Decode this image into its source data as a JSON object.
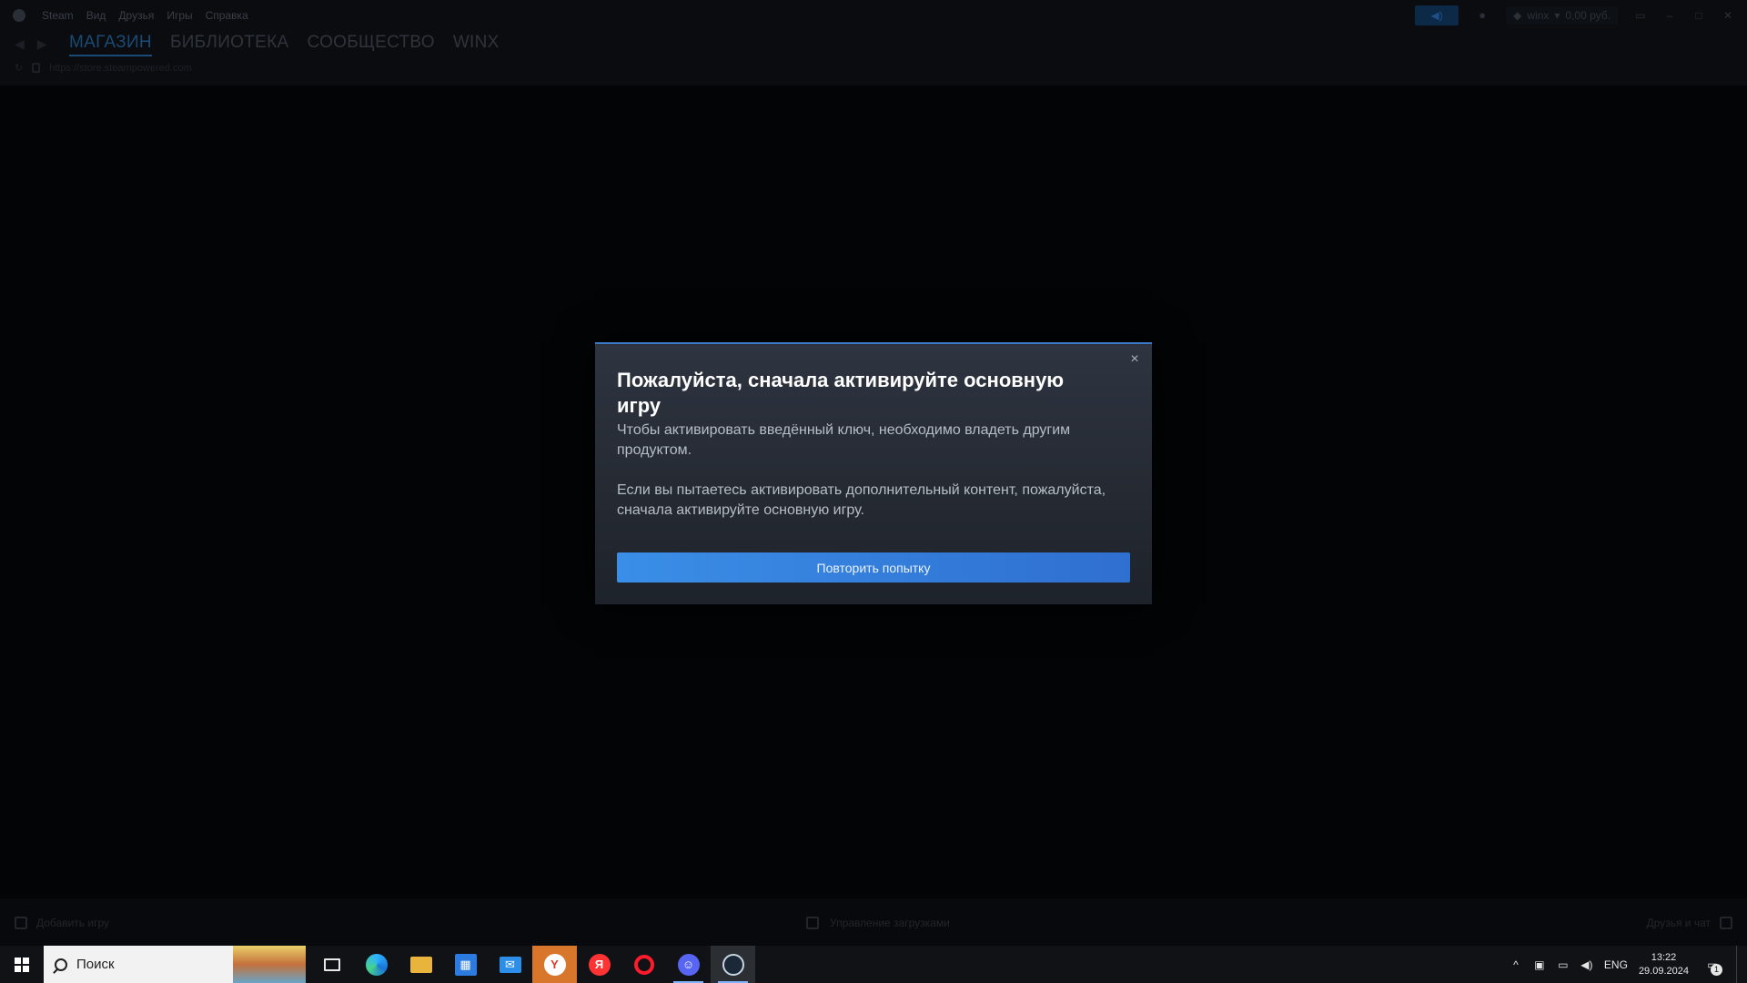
{
  "menu": {
    "items": [
      "Steam",
      "Вид",
      "Друзья",
      "Игры",
      "Справка"
    ]
  },
  "titlebar": {
    "user": "winx",
    "balance": "0,00 руб."
  },
  "nav": {
    "tabs": [
      "МАГАЗИН",
      "БИБЛИОТЕКА",
      "СООБЩЕСТВО",
      "WINX"
    ],
    "active_tab": 0,
    "url": "https://store.steampowered.com"
  },
  "bottombar": {
    "add_game": "Добавить игру",
    "downloads": "Управление загрузками",
    "friends": "Друзья и чат"
  },
  "modal": {
    "title": "Пожалуйста, сначала активируйте основную игру",
    "paragraph1": "Чтобы активировать введённый ключ, необходимо владеть другим продуктом.",
    "paragraph2": "Если вы пытаетесь активировать дополнительный контент, пожалуйста, сначала активируйте основную игру.",
    "button": "Повторить попытку",
    "close_glyph": "×"
  },
  "taskbar": {
    "search_placeholder": "Поиск",
    "language": "ENG",
    "time": "13:22",
    "date": "29.09.2024",
    "notification_count": "1"
  },
  "colors": {
    "accent": "#3c79c8",
    "button": "#2f6fd0",
    "modal_bg": "#2a2f39"
  }
}
